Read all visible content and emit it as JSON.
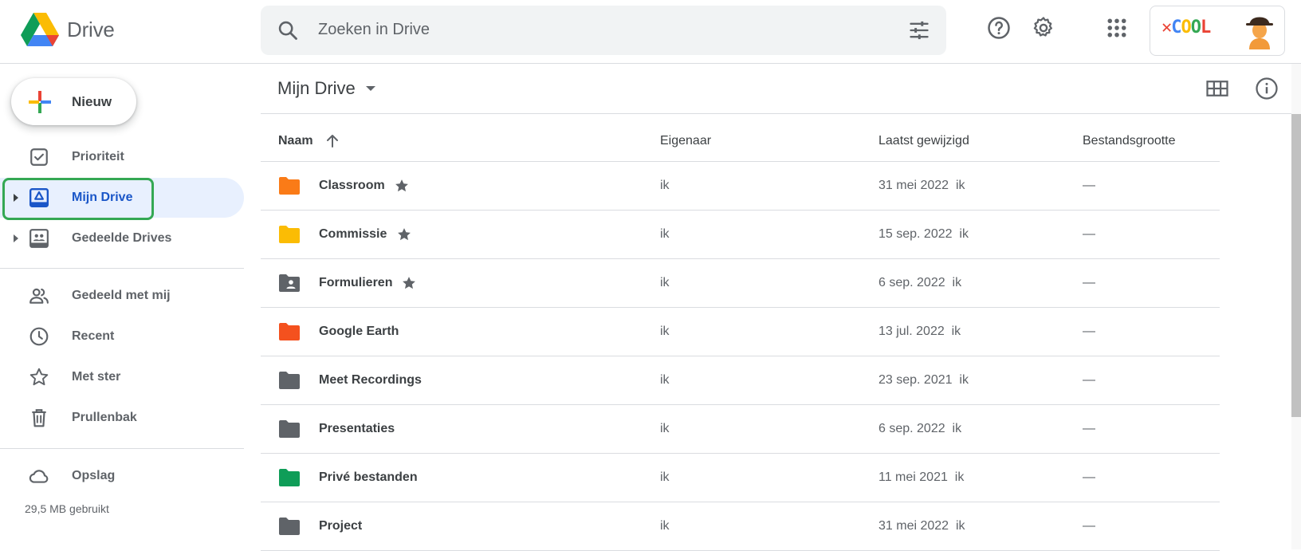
{
  "app": {
    "name": "Drive"
  },
  "search": {
    "placeholder": "Zoeken in Drive"
  },
  "account": {
    "badge_text": "COOL"
  },
  "sidebar": {
    "new_label": "Nieuw",
    "items": [
      {
        "label": "Prioriteit",
        "icon": "priority-icon"
      },
      {
        "label": "Mijn Drive",
        "icon": "my-drive-icon",
        "active": true
      },
      {
        "label": "Gedeelde Drives",
        "icon": "shared-drives-icon"
      },
      {
        "label": "Gedeeld met mij",
        "icon": "shared-with-me-icon"
      },
      {
        "label": "Recent",
        "icon": "clock-icon"
      },
      {
        "label": "Met ster",
        "icon": "star-icon"
      },
      {
        "label": "Prullenbak",
        "icon": "trash-icon"
      },
      {
        "label": "Opslag",
        "icon": "cloud-icon"
      }
    ],
    "storage_used": "29,5 MB gebruikt"
  },
  "main": {
    "path": "Mijn Drive",
    "columns": {
      "name": "Naam",
      "owner": "Eigenaar",
      "modified": "Laatst gewijzigd",
      "size": "Bestandsgrootte"
    },
    "rows": [
      {
        "name": "Classroom",
        "starred": true,
        "owner": "ik",
        "modified": "31 mei 2022",
        "modified_by": "ik",
        "size": "—",
        "color": "#fa7b17",
        "icon": "folder-icon"
      },
      {
        "name": "Commissie",
        "starred": true,
        "owner": "ik",
        "modified": "15 sep. 2022",
        "modified_by": "ik",
        "size": "—",
        "color": "#fbbc04",
        "icon": "folder-icon"
      },
      {
        "name": "Formulieren",
        "starred": true,
        "owner": "ik",
        "modified": "6 sep. 2022",
        "modified_by": "ik",
        "size": "—",
        "color": "#5f6368",
        "icon": "shared-folder-icon"
      },
      {
        "name": "Google Earth",
        "starred": false,
        "owner": "ik",
        "modified": "13 jul. 2022",
        "modified_by": "ik",
        "size": "—",
        "color": "#f4511e",
        "icon": "folder-icon"
      },
      {
        "name": "Meet Recordings",
        "starred": false,
        "owner": "ik",
        "modified": "23 sep. 2021",
        "modified_by": "ik",
        "size": "—",
        "color": "#5f6368",
        "icon": "folder-icon"
      },
      {
        "name": "Presentaties",
        "starred": false,
        "owner": "ik",
        "modified": "6 sep. 2022",
        "modified_by": "ik",
        "size": "—",
        "color": "#5f6368",
        "icon": "folder-icon"
      },
      {
        "name": "Privé bestanden",
        "starred": false,
        "owner": "ik",
        "modified": "11 mei 2021",
        "modified_by": "ik",
        "size": "—",
        "color": "#0f9d58",
        "icon": "folder-icon"
      },
      {
        "name": "Project",
        "starred": false,
        "owner": "ik",
        "modified": "31 mei 2022",
        "modified_by": "ik",
        "size": "—",
        "color": "#5f6368",
        "icon": "folder-icon"
      }
    ]
  }
}
